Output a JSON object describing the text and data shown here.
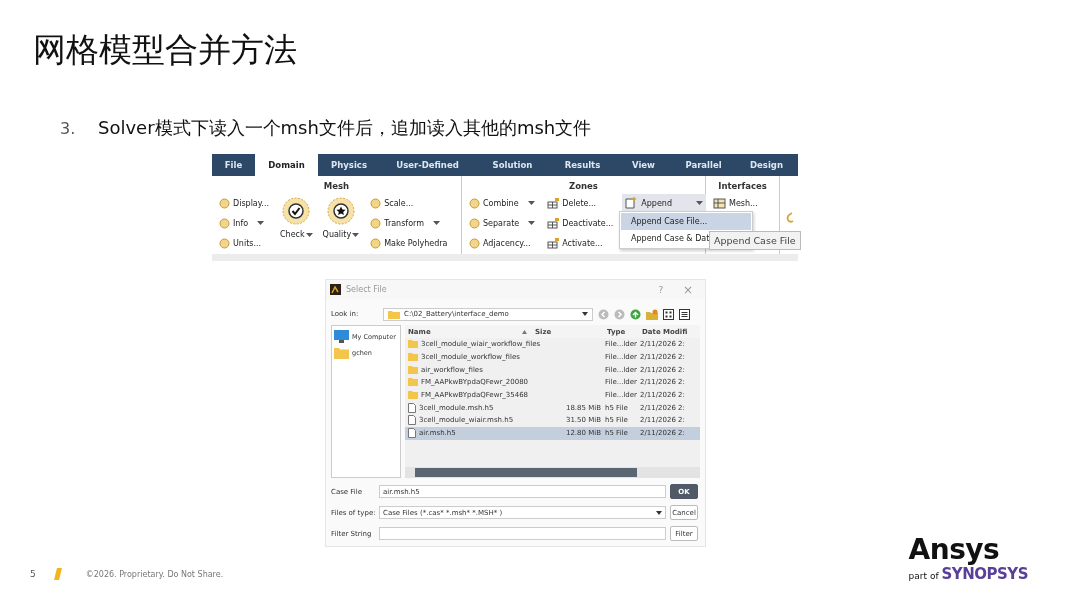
{
  "slide": {
    "title": "网格模型合并方法",
    "bullet": {
      "number": "3.",
      "text": "Solver模式下读入一个msh文件后，追加读入其他的msh文件"
    }
  },
  "ribbon": {
    "tabs": [
      {
        "label": "File",
        "selected": false
      },
      {
        "label": "Domain",
        "selected": true
      },
      {
        "label": "Physics",
        "selected": false
      },
      {
        "label": "User-Defined",
        "selected": false
      },
      {
        "label": "Solution",
        "selected": false
      },
      {
        "label": "Results",
        "selected": false
      },
      {
        "label": "View",
        "selected": false
      },
      {
        "label": "Parallel",
        "selected": false
      },
      {
        "label": "Design",
        "selected": false
      }
    ],
    "groups": [
      {
        "title": "Mesh",
        "columns": [
          [
            {
              "kind": "small",
              "label": "Display...",
              "dropdown": false,
              "active": false
            },
            {
              "kind": "small",
              "label": "Info",
              "dropdown": true,
              "active": false
            },
            {
              "kind": "small",
              "label": "Units...",
              "dropdown": false,
              "active": false
            }
          ],
          [
            {
              "kind": "large",
              "label": "Check",
              "dropdown": true,
              "active": false
            }
          ],
          [
            {
              "kind": "large",
              "label": "Quality",
              "dropdown": true,
              "active": false
            }
          ],
          [
            {
              "kind": "small",
              "label": "Scale...",
              "dropdown": false,
              "active": false
            },
            {
              "kind": "small",
              "label": "Transform",
              "dropdown": true,
              "active": false
            },
            {
              "kind": "small",
              "label": "Make Polyhedra",
              "dropdown": false,
              "active": false
            }
          ]
        ]
      },
      {
        "title": "Zones",
        "columns": [
          [
            {
              "kind": "small",
              "label": "Combine",
              "dropdown": true,
              "active": false
            },
            {
              "kind": "small",
              "label": "Separate",
              "dropdown": true,
              "active": false
            },
            {
              "kind": "small",
              "label": "Adjacency...",
              "dropdown": false,
              "active": false
            }
          ],
          [
            {
              "kind": "small",
              "label": "Delete...",
              "dropdown": false,
              "active": false
            },
            {
              "kind": "small",
              "label": "Deactivate...",
              "dropdown": false,
              "active": false
            },
            {
              "kind": "small",
              "label": "Activate...",
              "dropdown": false,
              "active": false
            }
          ],
          [
            {
              "kind": "small",
              "label": "Append",
              "dropdown": true,
              "active": true
            }
          ]
        ]
      },
      {
        "title": "Interfaces",
        "columns": [
          [
            {
              "kind": "small",
              "label": "Mesh...",
              "dropdown": false,
              "active": false
            }
          ]
        ]
      }
    ],
    "menu": [
      {
        "label": "Append Case File...",
        "selected": true
      },
      {
        "label": "Append Case & Dat",
        "selected": false
      }
    ],
    "tooltip": "Append Case File"
  },
  "dialog": {
    "title": "Select File",
    "help": "?",
    "close": "×",
    "look_in_label": "Look in:",
    "path": "C:\\02_Battery\\interface_demo",
    "places": [
      {
        "kind": "computer",
        "label": "My Computer"
      },
      {
        "kind": "folder",
        "label": "gchen"
      }
    ],
    "columns": [
      {
        "label": "Name",
        "sorted": true
      },
      {
        "label": "Size",
        "sorted": false
      },
      {
        "label": "Type",
        "sorted": false
      },
      {
        "label": "Date Modifi",
        "sorted": false
      }
    ],
    "rows": [
      {
        "kind": "folder",
        "name": "3cell_module_wiair_workflow_files",
        "type": "File...lder",
        "date": "2/11/2026 2:",
        "selected": false
      },
      {
        "kind": "folder",
        "name": "3cell_module_workflow_files",
        "type": "File...lder",
        "date": "2/11/2026 2:",
        "selected": false
      },
      {
        "kind": "folder",
        "name": "air_workflow_files",
        "type": "File...lder",
        "date": "2/11/2026 2:",
        "selected": false
      },
      {
        "kind": "folder",
        "name": "FM_AAPkwBYpdaQFewr_20080",
        "type": "File...lder",
        "date": "2/11/2026 2:",
        "selected": false
      },
      {
        "kind": "folder",
        "name": "FM_AAPkwBYpdaQFewr_35468",
        "type": "File...lder",
        "date": "2/11/2026 2:",
        "selected": false
      },
      {
        "kind": "file",
        "name": "3cell_module.msh.h5",
        "size": "18.85 MiB",
        "type": "h5 File",
        "date": "2/11/2026 2:",
        "selected": false
      },
      {
        "kind": "file",
        "name": "3cell_module_wiair.msh.h5",
        "size": "31.50 MiB",
        "type": "h5 File",
        "date": "2/11/2026 2:",
        "selected": false
      },
      {
        "kind": "file",
        "name": "air.msh.h5",
        "size": "12.80 MiB",
        "type": "h5 File",
        "date": "2/11/2026 2:",
        "selected": true
      }
    ],
    "case_file_label": "Case File",
    "case_file": "air.msh.h5",
    "ok": "OK",
    "type_label": "Files of type:",
    "type_value": "Case Files (*.cas* *.msh* *.MSH* )",
    "cancel": "Cancel",
    "filter_label": "Filter String",
    "filter": "Filter"
  },
  "footer": {
    "page": "5",
    "copyright": "©2026. Proprietary. Do Not Share.",
    "logo": "Ansys",
    "logo_sub": "part of",
    "logo_parent": "SYNOPSYS"
  }
}
